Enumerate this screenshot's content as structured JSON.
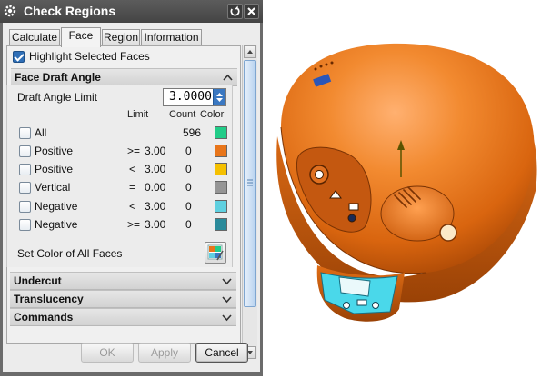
{
  "window": {
    "title": "Check Regions"
  },
  "icons": {
    "settings": "gear-icon",
    "reset": "reset-icon",
    "close": "close-icon",
    "expand": "chevron-down-icon",
    "collapse": "chevron-up-icon",
    "set_color": "palette-icon"
  },
  "tabs": [
    {
      "label": "Calculate"
    },
    {
      "label": "Face",
      "active": true
    },
    {
      "label": "Region"
    },
    {
      "label": "Information"
    }
  ],
  "highlight": {
    "label": "Highlight Selected Faces",
    "checked": true
  },
  "face_draft_angle": {
    "title": "Face Draft Angle",
    "limit_label": "Draft Angle Limit",
    "limit_value": "3.0000",
    "headers": {
      "limit": "Limit",
      "count": "Count",
      "color": "Color"
    },
    "rows": [
      {
        "label": "All",
        "op": "",
        "limit": "",
        "count": "596",
        "color": "#22cc88",
        "checked": false
      },
      {
        "label": "Positive",
        "op": ">=",
        "limit": "3.00",
        "count": "0",
        "color": "#e8751a",
        "checked": false
      },
      {
        "label": "Positive",
        "op": "<",
        "limit": "3.00",
        "count": "0",
        "color": "#f5c000",
        "checked": false
      },
      {
        "label": "Vertical",
        "op": "=",
        "limit": "0.00",
        "count": "0",
        "color": "#959595",
        "checked": false
      },
      {
        "label": "Negative",
        "op": "<",
        "limit": "3.00",
        "count": "0",
        "color": "#5fd0e0",
        "checked": false
      },
      {
        "label": "Negative",
        "op": ">=",
        "limit": "3.00",
        "count": "0",
        "color": "#2a8a9a",
        "checked": false
      }
    ],
    "set_color_label": "Set Color of All Faces"
  },
  "sections": {
    "undercut": "Undercut",
    "translucency": "Translucency",
    "commands": "Commands"
  },
  "buttons": {
    "ok": "OK",
    "apply": "Apply",
    "cancel": "Cancel"
  },
  "colors": {
    "model_orange": "#e8751a",
    "model_cyan": "#4ad8ea",
    "titlebar": "#505050",
    "dialog_bg": "#ececec",
    "accent_blue": "#3a78c2"
  }
}
